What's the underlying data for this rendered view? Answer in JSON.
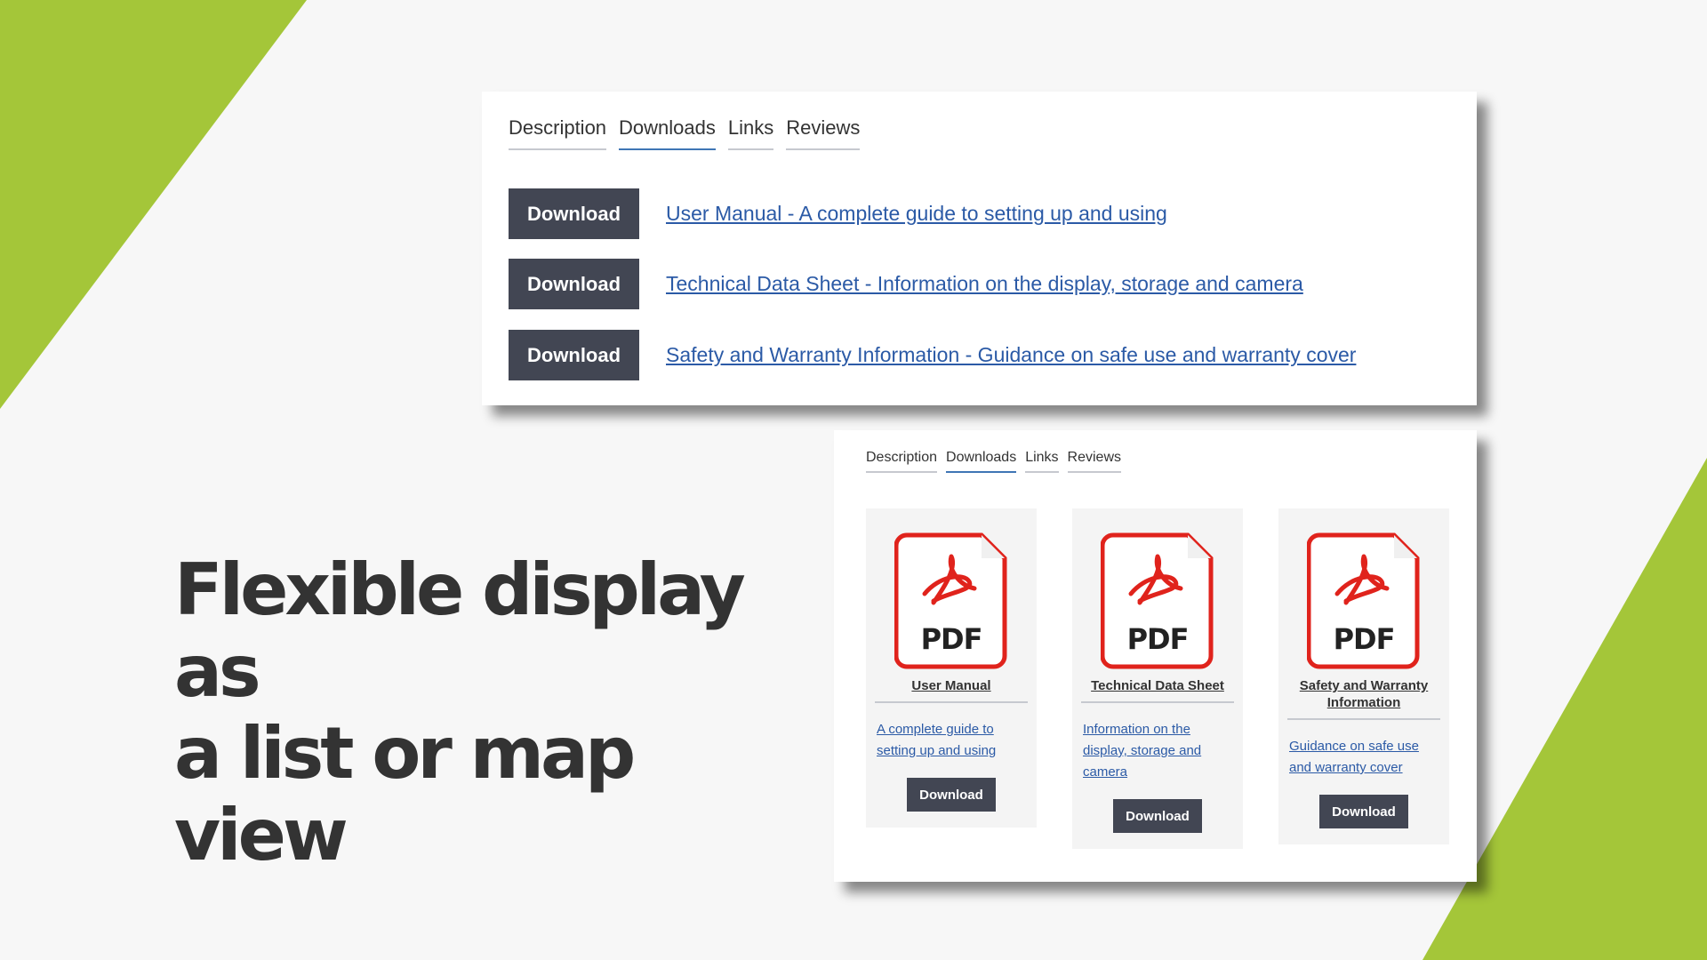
{
  "headline": [
    "Flexible display as",
    "a list or map view"
  ],
  "tabs": [
    "Description",
    "Downloads",
    "Links",
    "Reviews"
  ],
  "active_tab": "Downloads",
  "list_view": {
    "download_label": "Download",
    "items": [
      "User Manual - A complete guide to setting up and using",
      "Technical Data Sheet - Information on the display, storage and camera",
      "Safety and Warranty Information - Guidance on safe use and warranty cover"
    ]
  },
  "card_view": {
    "download_label": "Download",
    "pdf_label": "PDF",
    "items": [
      {
        "title": "User Manual",
        "description": "A complete guide to setting up and using"
      },
      {
        "title": "Technical Data Sheet",
        "description": "Information on the display, storage and camera"
      },
      {
        "title": "Safety and Warranty Information",
        "description": "Guidance on safe use and warranty cover"
      }
    ]
  },
  "colors": {
    "accent_green": "#a4c639",
    "button_bg": "#424653",
    "link": "#2b5aa6",
    "pdf_red": "#e0231c",
    "active_tab_underline": "#3f76b5"
  },
  "icons": {
    "file": "pdf-file-icon"
  }
}
